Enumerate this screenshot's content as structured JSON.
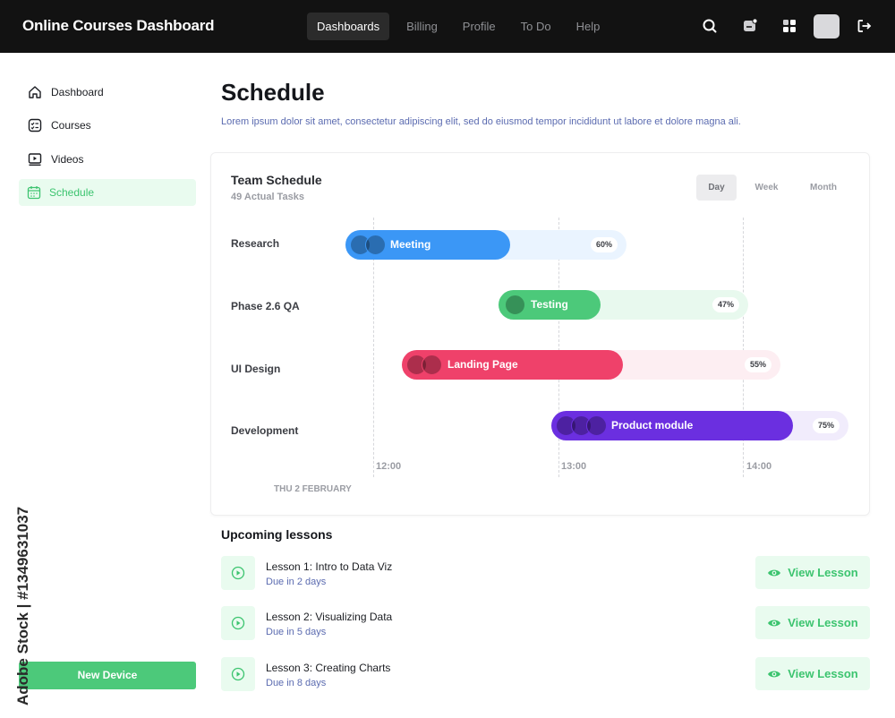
{
  "header": {
    "brand": "Online Courses Dashboard",
    "nav": [
      "Dashboards",
      "Billing",
      "Profile",
      "To Do",
      "Help"
    ],
    "active_nav": "Dashboards",
    "icons": [
      "search-icon",
      "chat-icon",
      "apps-icon",
      "avatar",
      "logout-icon"
    ]
  },
  "sidebar": {
    "items": [
      {
        "label": "Dashboard",
        "icon": "home-icon"
      },
      {
        "label": "Courses",
        "icon": "checklist-icon"
      },
      {
        "label": "Videos",
        "icon": "video-icon"
      },
      {
        "label": "Schedule",
        "icon": "calendar-icon",
        "active": true
      }
    ],
    "new_device": "New Device"
  },
  "watermark": "Adobe Stock | #1349631037",
  "page": {
    "title": "Schedule",
    "description": "Lorem ipsum dolor sit amet, consectetur adipiscing elit, sed do eiusmod  tempor incididunt ut labore et dolore magna ali."
  },
  "schedule": {
    "title": "Team Schedule",
    "subtitle": "49 Actual Tasks",
    "views": [
      "Day",
      "Week",
      "Month"
    ],
    "active_view": "Day",
    "times": [
      "12:00",
      "13:00",
      "14:00"
    ],
    "date": "THU 2 FEBRUARY",
    "rows": [
      {
        "label": "Research",
        "task": "Meeting",
        "progress": "60%",
        "color": "#3b97f6",
        "track": "#eaf4ff"
      },
      {
        "label": "Phase 2.6 QA",
        "task": "Testing",
        "progress": "47%",
        "color": "#4cc97a",
        "track": "#e8f9ee"
      },
      {
        "label": "UI Design",
        "task": "Landing Page",
        "progress": "55%",
        "color": "#ef416a",
        "track": "#fdeef2"
      },
      {
        "label": "Development",
        "task": "Product module",
        "progress": "75%",
        "color": "#6b2fe0",
        "track": "#f1ecfc"
      }
    ]
  },
  "lessons": {
    "title": "Upcoming lessons",
    "button_label": "View Lesson",
    "items": [
      {
        "name": "Lesson 1: Intro to Data Viz",
        "due": "Due in 2 days"
      },
      {
        "name": "Lesson 2: Visualizing Data",
        "due": "Due in 5 days"
      },
      {
        "name": "Lesson 3: Creating Charts",
        "due": "Due in 8 days"
      }
    ]
  },
  "colors": {
    "accent_green": "#4cc97a",
    "header_bg": "#121212",
    "link_blue": "#5b6bb0"
  }
}
